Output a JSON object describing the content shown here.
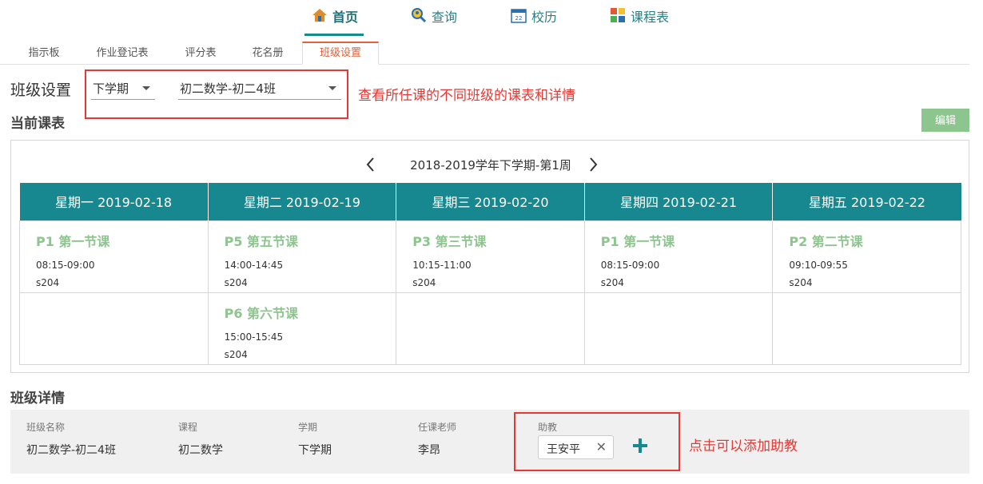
{
  "nav": {
    "items": [
      {
        "label": "首页",
        "icon": "home-icon"
      },
      {
        "label": "查询",
        "icon": "search-person-icon"
      },
      {
        "label": "校历",
        "icon": "calendar-icon"
      },
      {
        "label": "课程表",
        "icon": "schedule-grid-icon"
      }
    ],
    "active_index": 0
  },
  "tabs": [
    "指示板",
    "作业登记表",
    "评分表",
    "花名册",
    "班级设置"
  ],
  "active_tab_index": 4,
  "settings": {
    "title": "班级设置",
    "term_select": "下学期",
    "class_select": "初二数学-初二4班",
    "annotation": "查看所任课的不同班级的课表和详情"
  },
  "schedule": {
    "section_title": "当前课表",
    "edit_label": "编辑",
    "week_label": "2018-2019学年下学期-第1周",
    "days": [
      "星期一 2019-02-18",
      "星期二 2019-02-19",
      "星期三 2019-02-20",
      "星期四 2019-02-21",
      "星期五 2019-02-22"
    ],
    "rows": [
      [
        {
          "name": "P1 第一节课",
          "time": "08:15-09:00",
          "room": "s204"
        },
        {
          "name": "P5 第五节课",
          "time": "14:00-14:45",
          "room": "s204"
        },
        {
          "name": "P3 第三节课",
          "time": "10:15-11:00",
          "room": "s204"
        },
        {
          "name": "P1 第一节课",
          "time": "08:15-09:00",
          "room": "s204"
        },
        {
          "name": "P2 第二节课",
          "time": "09:10-09:55",
          "room": "s204"
        }
      ],
      [
        null,
        {
          "name": "P6 第六节课",
          "time": "15:00-15:45",
          "room": "s204"
        },
        null,
        null,
        null
      ]
    ]
  },
  "details": {
    "section_title": "班级详情",
    "labels": {
      "class_name": "班级名称",
      "course": "课程",
      "term": "学期",
      "teacher": "任课老师",
      "assistant": "助教"
    },
    "values": {
      "class_name": "初二数学-初二4班",
      "course": "初二数学",
      "term": "下学期",
      "teacher": "李昂",
      "assistant": "王安平"
    },
    "annotation": "点击可以添加助教"
  },
  "colors": {
    "teal": "#188890",
    "lesson_green": "#8dc58e",
    "annotation_red": "#e53935",
    "active_tab": "#e0613a"
  }
}
